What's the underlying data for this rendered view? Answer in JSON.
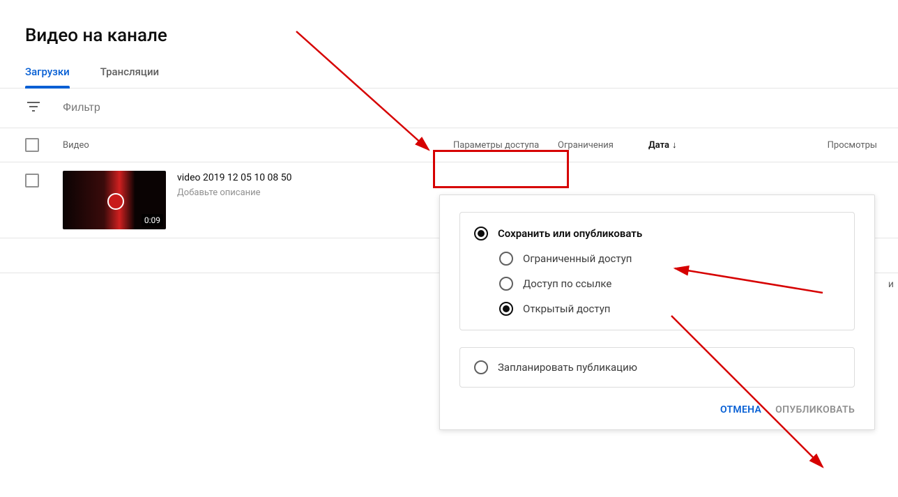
{
  "page": {
    "title": "Видео на канале"
  },
  "tabs": {
    "uploads": "Загрузки",
    "live": "Трансляции"
  },
  "filter": {
    "placeholder": "Фильтр"
  },
  "columns": {
    "video": "Видео",
    "access": "Параметры доступа",
    "restrictions": "Ограничения",
    "date": "Дата",
    "views": "Просмотры"
  },
  "video": {
    "title": "video 2019 12 05 10 08 50",
    "description_placeholder": "Добавьте описание",
    "duration": "0:09"
  },
  "dropdown": {
    "save_or_publish": "Сохранить или опубликовать",
    "private": "Ограниченный доступ",
    "unlisted": "Доступ по ссылке",
    "public": "Открытый доступ",
    "schedule": "Запланировать публикацию",
    "cancel": "ОТМЕНА",
    "publish": "ОПУБЛИКОВАТЬ"
  },
  "misc": {
    "side_char": "и"
  }
}
